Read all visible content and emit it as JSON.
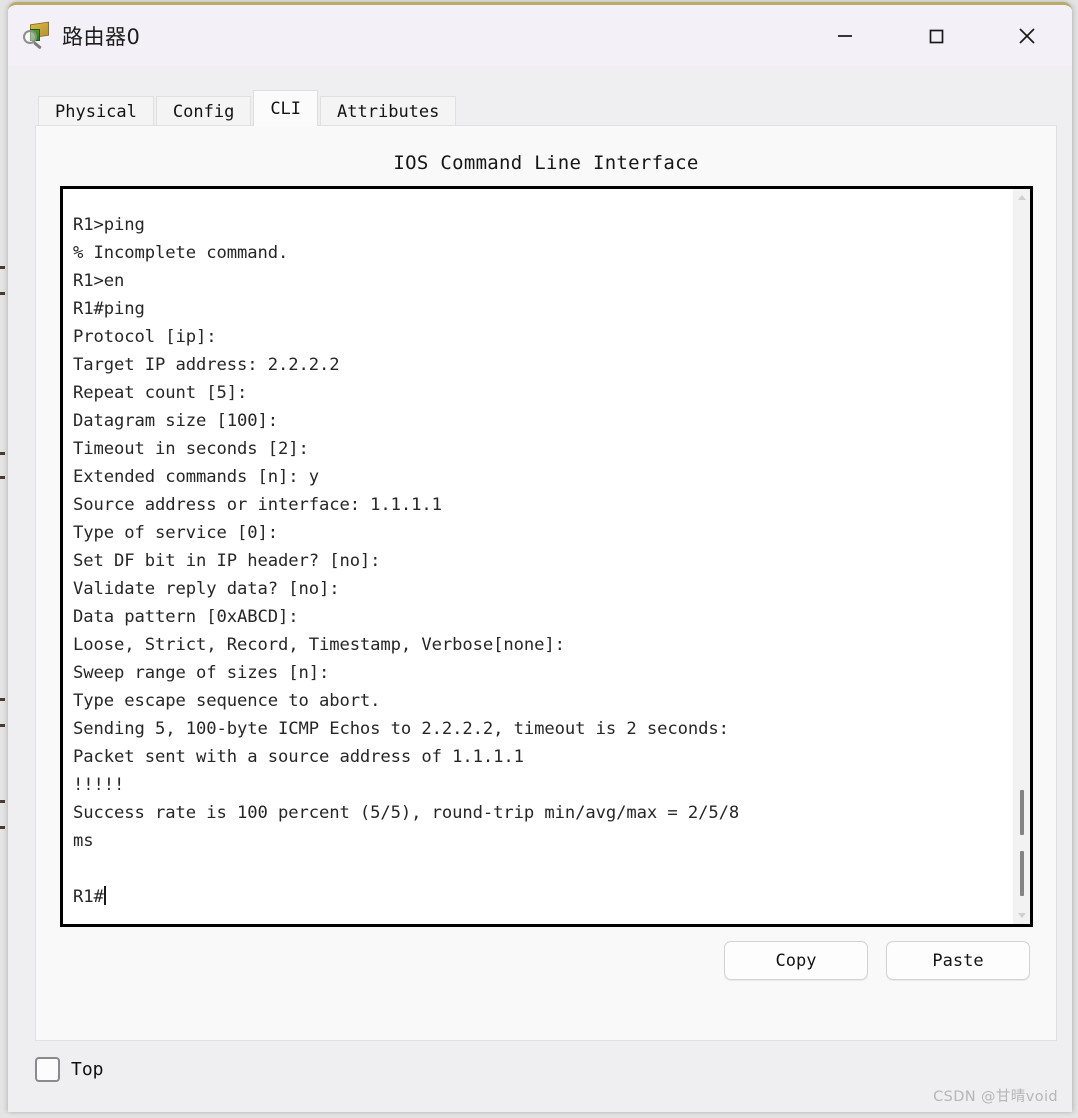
{
  "window": {
    "title": "路由器0",
    "icon": "inspect-router-icon",
    "controls": {
      "minimize": "minimize-icon",
      "maximize": "maximize-icon",
      "close": "close-icon"
    }
  },
  "tabs": [
    {
      "label": "Physical",
      "active": false
    },
    {
      "label": "Config",
      "active": false
    },
    {
      "label": "CLI",
      "active": true
    },
    {
      "label": "Attributes",
      "active": false
    }
  ],
  "panel": {
    "heading": "IOS Command Line Interface"
  },
  "terminal": {
    "lines": [
      "R1>ping",
      "% Incomplete command.",
      "R1>en",
      "R1#ping",
      "Protocol [ip]:",
      "Target IP address: 2.2.2.2",
      "Repeat count [5]:",
      "Datagram size [100]:",
      "Timeout in seconds [2]:",
      "Extended commands [n]: y",
      "Source address or interface: 1.1.1.1",
      "Type of service [0]:",
      "Set DF bit in IP header? [no]:",
      "Validate reply data? [no]:",
      "Data pattern [0xABCD]:",
      "Loose, Strict, Record, Timestamp, Verbose[none]:",
      "Sweep range of sizes [n]:",
      "Type escape sequence to abort.",
      "Sending 5, 100-byte ICMP Echos to 2.2.2.2, timeout is 2 seconds:",
      "Packet sent with a source address of 1.1.1.1",
      "!!!!!",
      "Success rate is 100 percent (5/5), round-trip min/avg/max = 2/5/8",
      "ms",
      "",
      "R1#"
    ]
  },
  "buttons": {
    "copy": "Copy",
    "paste": "Paste"
  },
  "options": {
    "top_label": "Top",
    "top_checked": false
  },
  "watermark": "CSDN @甘晴void",
  "colors": {
    "titlebar": "#f3f1f7",
    "window_bg": "#efeff1",
    "panel_bg": "#f9f9f9",
    "terminal_bg": "#ffffff",
    "terminal_text": "#262626",
    "top_border_accent": "#b9ab6a"
  }
}
